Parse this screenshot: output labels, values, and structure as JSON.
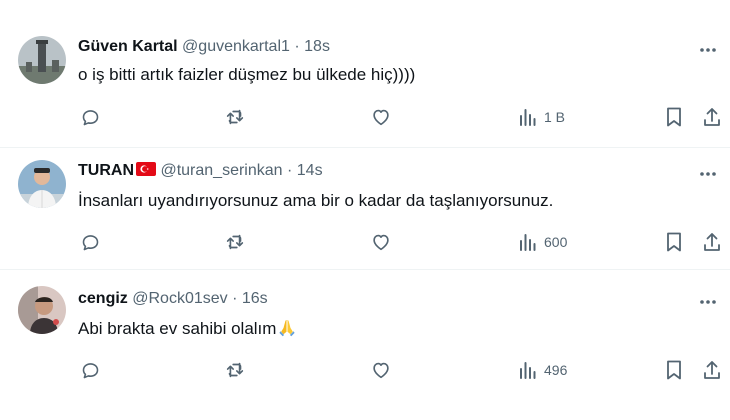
{
  "tweets": [
    {
      "name": "Güven Kartal",
      "handle": "@guvenkartal1",
      "separator": "·",
      "time": "18s",
      "text": "o iş bitti artık faizler düşmez bu ülkede hiç))))",
      "views": "1 B",
      "flag": ""
    },
    {
      "name": "TURAN",
      "handle": "@turan_serinkan",
      "separator": "·",
      "time": "14s",
      "text": "İnsanları uyandırıyorsunuz ama bir o kadar da taşlanıyorsunuz.",
      "views": "600",
      "flag": "turkey-flag"
    },
    {
      "name": "cengiz",
      "handle": "@Rock01sev",
      "separator": "·",
      "time": "16s",
      "text": "Abi brakta ev sahibi olalım",
      "views": "496",
      "flag": ""
    }
  ],
  "icons": {
    "reply": "reply-icon",
    "retweet": "retweet-icon",
    "like": "heart-icon",
    "views": "views-chart-icon",
    "bookmark": "bookmark-icon",
    "share": "share-icon",
    "more": "more-options-icon",
    "emoji": "folded-hands-emoji"
  },
  "colors": {
    "text": "#0f1419",
    "secondary": "#536471",
    "divider": "#eff3f4",
    "flag_red": "#e30a17"
  }
}
